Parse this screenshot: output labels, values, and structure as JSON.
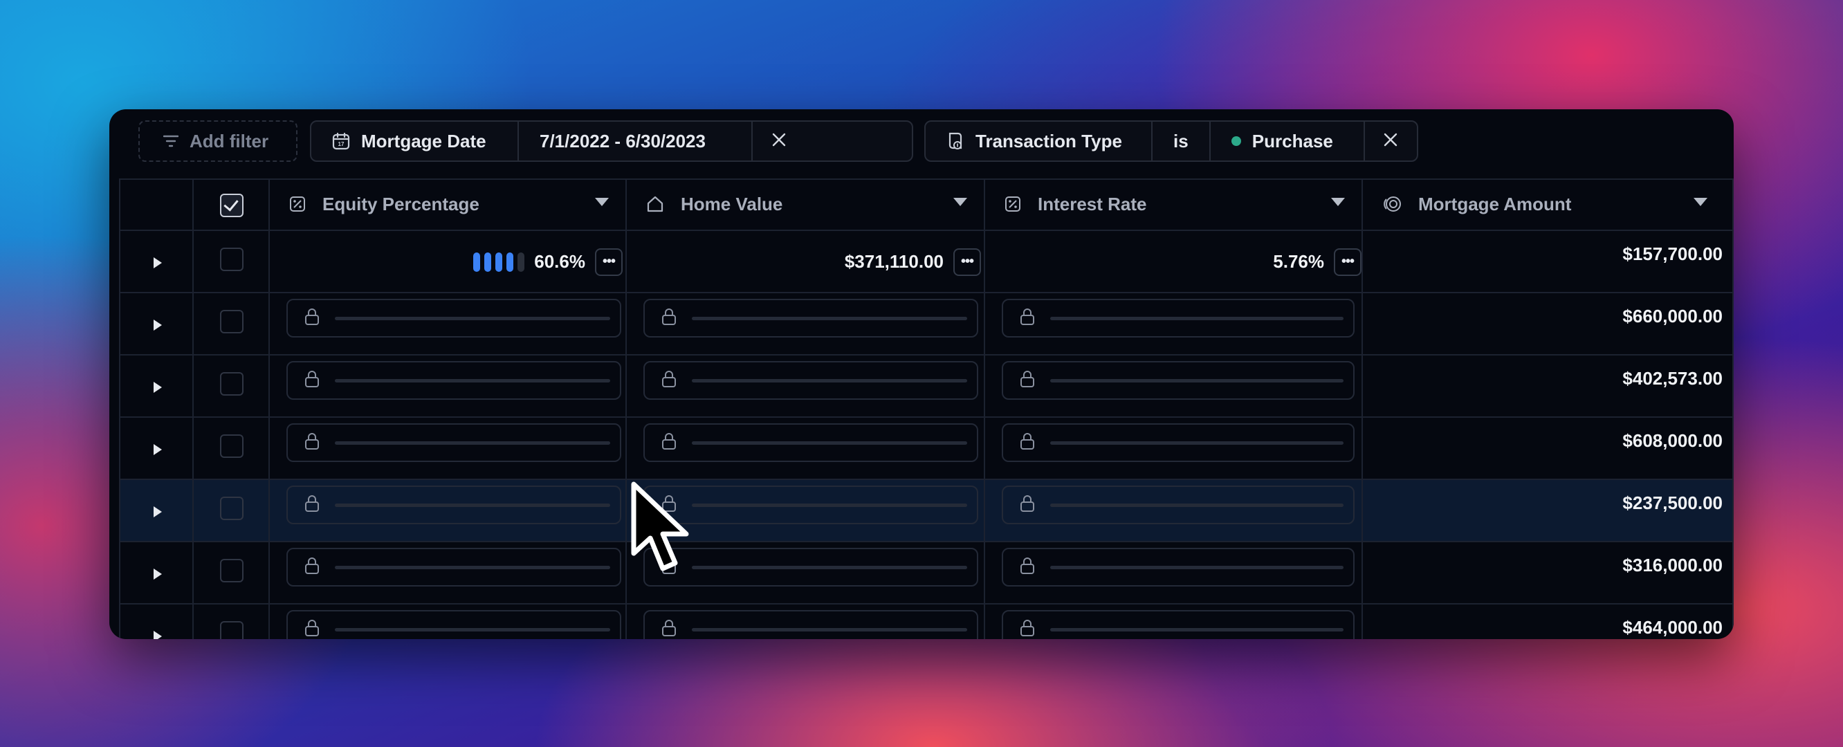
{
  "filters": {
    "add_filter_label": "Add filter",
    "date_filter": {
      "field": "Mortgage Date",
      "value": "7/1/2022 - 6/30/2023"
    },
    "type_filter": {
      "field": "Transaction Type",
      "operator": "is",
      "value": "Purchase",
      "value_color": "#2ca98a"
    }
  },
  "columns": [
    {
      "label": "Equity Percentage",
      "icon": "percent-icon"
    },
    {
      "label": "Home Value",
      "icon": "home-icon"
    },
    {
      "label": "Interest Rate",
      "icon": "percent-icon"
    },
    {
      "label": "Mortgage Amount",
      "icon": "coins-icon"
    }
  ],
  "first_row": {
    "equity_percentage": "60.6%",
    "equity_bar_level": 0.8,
    "home_value": "$371,110.00",
    "interest_rate": "5.76%",
    "mortgage_amount": "$157,700.00"
  },
  "mortgage_amounts": [
    "$157,700.00",
    "$660,000.00",
    "$402,573.00",
    "$608,000.00",
    "$237,500.00",
    "$316,000.00",
    "$464,000.00"
  ],
  "colors": {
    "accent": "#3b82f6",
    "panel": "#050810"
  }
}
